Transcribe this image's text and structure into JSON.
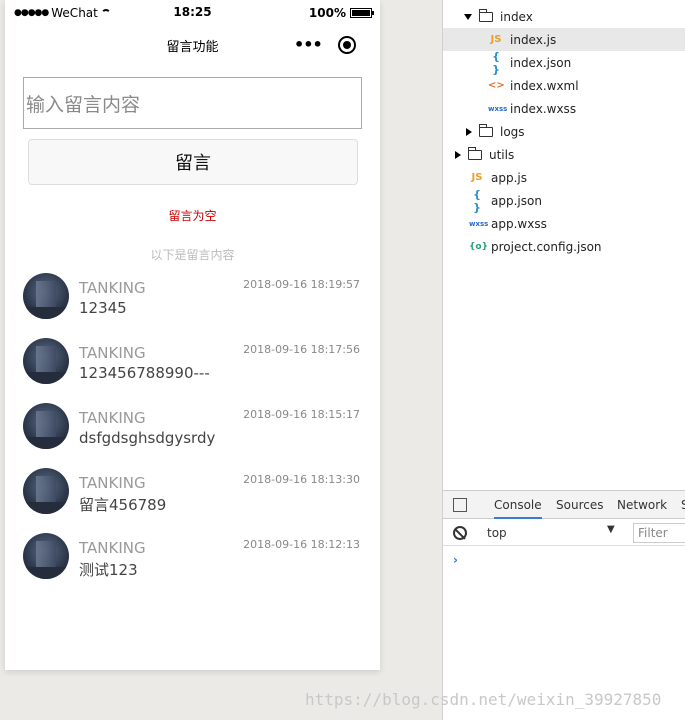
{
  "status_bar": {
    "carrier": "WeChat",
    "time": "18:25",
    "battery": "100%"
  },
  "nav": {
    "title": "留言功能",
    "menu": "•••"
  },
  "form": {
    "placeholder": "输入留言内容",
    "submit": "留言",
    "warning": "留言为空"
  },
  "list": {
    "divider": "以下是留言内容",
    "items": [
      {
        "name": "TANKING",
        "time": "2018-09-16 18:19:57",
        "content": "12345"
      },
      {
        "name": "TANKING",
        "time": "2018-09-16 18:17:56",
        "content": "123456788990---"
      },
      {
        "name": "TANKING",
        "time": "2018-09-16 18:15:17",
        "content": "dsfgdsghsdgysrdy"
      },
      {
        "name": "TANKING",
        "time": "2018-09-16 18:13:30",
        "content": "留言456789"
      },
      {
        "name": "TANKING",
        "time": "2018-09-16 18:12:13",
        "content": "测试123"
      }
    ]
  },
  "file_tree": {
    "index_folder": "index",
    "index_js": "index.js",
    "index_json": "index.json",
    "index_wxml": "index.wxml",
    "index_wxss": "index.wxss",
    "logs": "logs",
    "utils": "utils",
    "app_js": "app.js",
    "app_json": "app.json",
    "app_wxss": "app.wxss",
    "project_config": "project.config.json"
  },
  "devtools": {
    "tabs": [
      "Console",
      "Sources",
      "Network",
      "S"
    ],
    "context": "top",
    "filter_placeholder": "Filter",
    "prompt": "›"
  },
  "icons": {
    "js": "JS",
    "json": "{ }",
    "wxml": "<>",
    "wxss": "wxss",
    "config": "{o}"
  },
  "watermark": "https://blog.csdn.net/weixin_39927850",
  "colors": {
    "warning": "#cc0000",
    "accent": "#3879d9"
  }
}
